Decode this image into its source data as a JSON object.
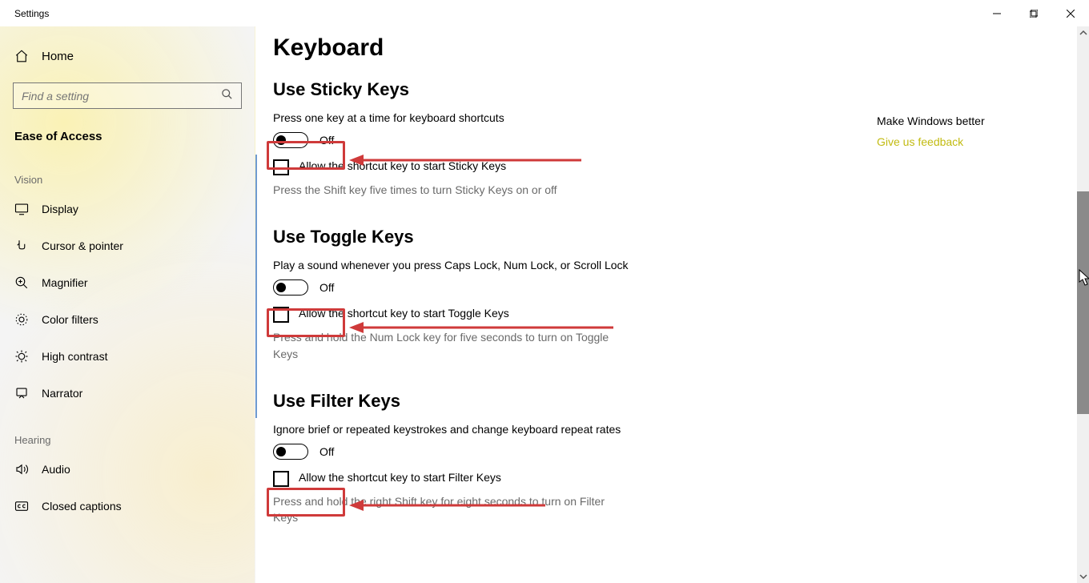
{
  "window": {
    "title": "Settings"
  },
  "sidebar": {
    "home": "Home",
    "search_placeholder": "Find a setting",
    "category": "Ease of Access",
    "groups": [
      {
        "label": "Vision",
        "items": [
          {
            "icon": "display-icon",
            "label": "Display"
          },
          {
            "icon": "cursor-pointer-icon",
            "label": "Cursor & pointer"
          },
          {
            "icon": "magnifier-icon",
            "label": "Magnifier"
          },
          {
            "icon": "color-filters-icon",
            "label": "Color filters"
          },
          {
            "icon": "high-contrast-icon",
            "label": "High contrast"
          },
          {
            "icon": "narrator-icon",
            "label": "Narrator"
          }
        ]
      },
      {
        "label": "Hearing",
        "items": [
          {
            "icon": "audio-icon",
            "label": "Audio"
          },
          {
            "icon": "closed-captions-icon",
            "label": "Closed captions"
          }
        ]
      }
    ]
  },
  "page": {
    "title": "Keyboard",
    "sections": [
      {
        "title": "Use Sticky Keys",
        "description": "Press one key at a time for keyboard shortcuts",
        "toggle_state": "Off",
        "checkbox_label": "Allow the shortcut key to start Sticky Keys",
        "hint": "Press the Shift key five times to turn Sticky Keys on or off"
      },
      {
        "title": "Use Toggle Keys",
        "description": "Play a sound whenever you press Caps Lock, Num Lock, or Scroll Lock",
        "toggle_state": "Off",
        "checkbox_label": "Allow the shortcut key to start Toggle Keys",
        "hint": "Press and hold the Num Lock key for five seconds to turn on Toggle Keys"
      },
      {
        "title": "Use Filter Keys",
        "description": "Ignore brief or repeated keystrokes and change keyboard repeat rates",
        "toggle_state": "Off",
        "checkbox_label": "Allow the shortcut key to start Filter Keys",
        "hint": "Press and hold the right Shift key for eight seconds to turn on Filter Keys"
      }
    ]
  },
  "right_panel": {
    "title": "Make Windows better",
    "link": "Give us feedback"
  }
}
